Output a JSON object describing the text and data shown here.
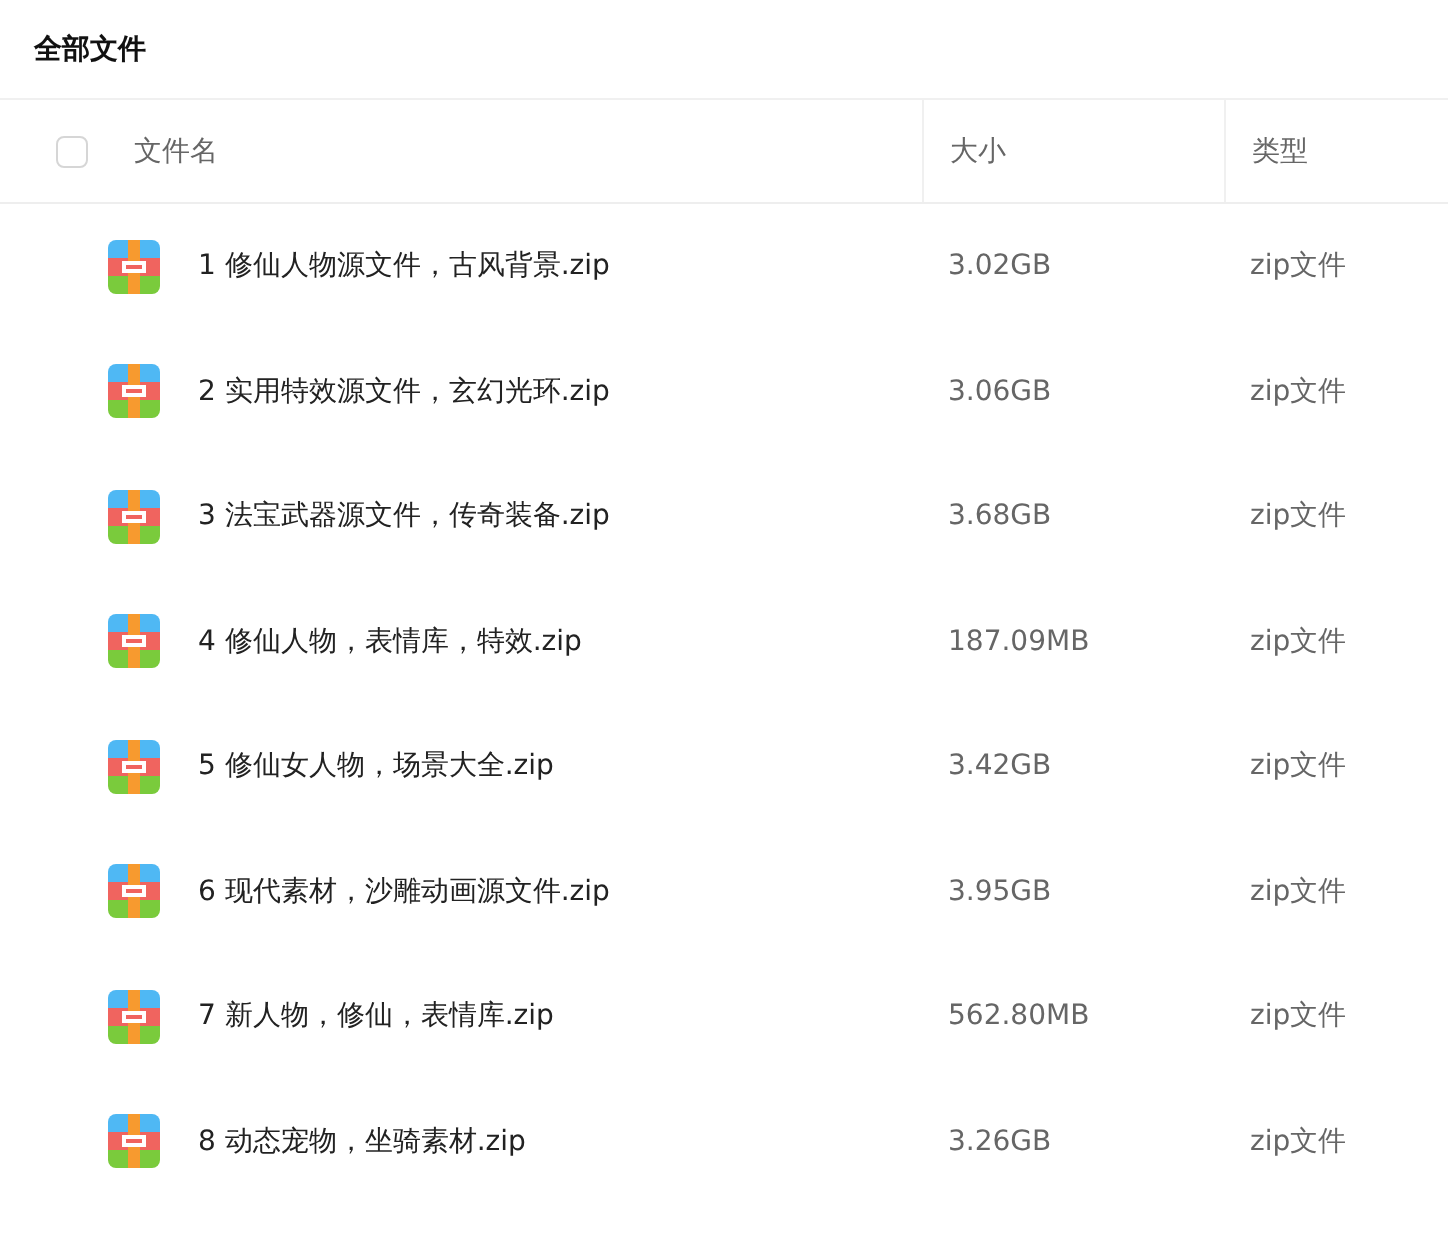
{
  "title": "全部文件",
  "table": {
    "select_all": {
      "checked": false
    },
    "columns": [
      "文件名",
      "大小",
      "类型"
    ],
    "rows": [
      {
        "name": "1 修仙人物源文件，古风背景.zip",
        "size": "3.02GB",
        "type": "zip文件"
      },
      {
        "name": "2 实用特效源文件，玄幻光环.zip",
        "size": "3.06GB",
        "type": "zip文件"
      },
      {
        "name": "3 法宝武器源文件，传奇装备.zip",
        "size": "3.68GB",
        "type": "zip文件"
      },
      {
        "name": "4 修仙人物，表情库，特效.zip",
        "size": "187.09MB",
        "type": "zip文件"
      },
      {
        "name": "5 修仙女人物，场景大全.zip",
        "size": "3.42GB",
        "type": "zip文件"
      },
      {
        "name": "6 现代素材，沙雕动画源文件.zip",
        "size": "3.95GB",
        "type": "zip文件"
      },
      {
        "name": "7 新人物，修仙，表情库.zip",
        "size": "562.80MB",
        "type": "zip文件"
      },
      {
        "name": "8 动态宠物，坐骑素材.zip",
        "size": "3.26GB",
        "type": "zip文件"
      }
    ]
  }
}
